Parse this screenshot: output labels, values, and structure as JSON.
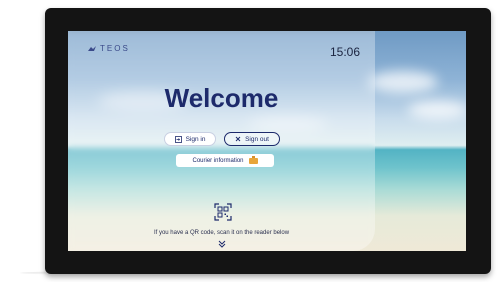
{
  "brand": {
    "name": "TEOS",
    "logo_icon": "bird-icon"
  },
  "clock": "15:06",
  "welcome": "Welcome",
  "buttons": {
    "sign_in": {
      "label": "Sign in",
      "icon": "sign-in-icon"
    },
    "sign_out": {
      "label": "Sign out",
      "icon": "close-icon"
    }
  },
  "courier": {
    "label": "Courier information",
    "icon": "package-icon"
  },
  "qr": {
    "icon": "qr-code-icon",
    "hint": "If you have a QR code, scan it on the reader below",
    "chevron_icon": "chevron-down-icon"
  },
  "colors": {
    "accent": "#1d2a6b",
    "device_frame": "#141414",
    "courier_icon": "#e8a53a"
  }
}
